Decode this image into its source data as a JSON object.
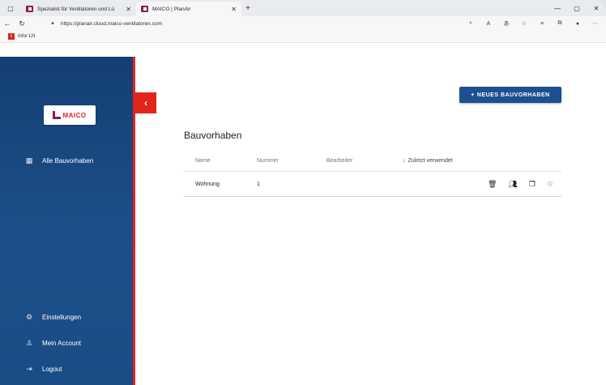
{
  "browser": {
    "tabs": [
      {
        "title": "Spezialist für Ventilatoren und Lü"
      },
      {
        "title": "MAICO | PlanAir"
      }
    ],
    "url": "https://planair.cloud.maico-ventilatoren.com",
    "bookmarks": [
      {
        "label": "Infor LN"
      }
    ]
  },
  "app": {
    "logo_text": "MAICO",
    "sidebar": {
      "items": [
        {
          "label": "Alle Bauvorhaben"
        },
        {
          "label": "Einstellungen"
        },
        {
          "label": "Mein Account"
        },
        {
          "label": "Logout"
        }
      ]
    },
    "new_project_label": "NEUES BAUVORHABEN",
    "page_title": "Bauvorhaben",
    "table": {
      "columns": [
        "Name",
        "Nummer",
        "Bearbeiter",
        "Zuletzt verwendet"
      ],
      "rows": [
        {
          "name": "Wohnung",
          "number": "1",
          "editor": "",
          "last_used": ""
        }
      ]
    }
  },
  "colors": {
    "sidebar_blue": "#1a4c86",
    "accent_red": "#e1251b",
    "button_blue": "#1d4f91"
  }
}
